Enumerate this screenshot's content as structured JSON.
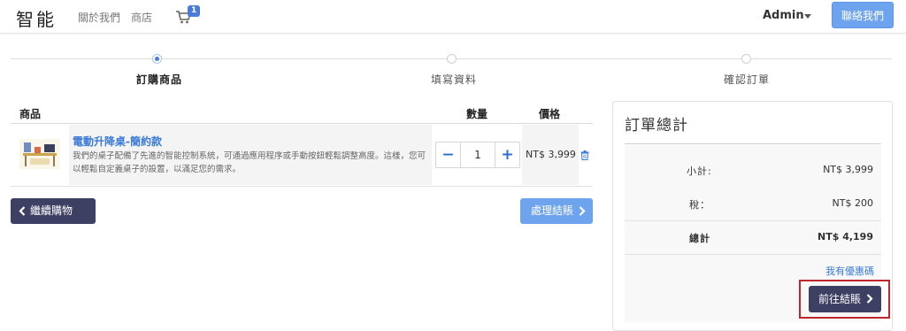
{
  "navbar": {
    "brand": "智能",
    "links": [
      "關於我們",
      "商店"
    ],
    "cart_count": "1",
    "user": "Admin",
    "contact_label": "聯絡我們"
  },
  "steps": [
    {
      "label": "訂購商品",
      "active": true
    },
    {
      "label": "填寫資料",
      "active": false
    },
    {
      "label": "確認訂單",
      "active": false
    }
  ],
  "cart_table": {
    "headers": {
      "product": "商品",
      "quantity": "數量",
      "price": "價格"
    },
    "items": [
      {
        "name": "電動升降桌-簡約款",
        "description": "我們的桌子配備了先進的智能控制系統，可通過應用程序或手動按鈕輕鬆調整高度。這樣，您可以輕鬆自定義桌子的設置，以滿足您的需求。",
        "quantity": "1",
        "price": "NT$ 3,999"
      }
    ],
    "continue_label": "繼續購物",
    "process_label": "處理結賬"
  },
  "summary": {
    "title": "訂單總計",
    "subtotal_label": "小計:",
    "subtotal": "NT$ 3,999",
    "tax_label": "稅：",
    "tax": "NT$ 200",
    "total_label": "總計",
    "total": "NT$ 4,199",
    "coupon_label": "我有優惠碼",
    "checkout_label": "前往結賬"
  },
  "colors": {
    "primary_blue": "#6ea3ee",
    "dark_button": "#3d3f63",
    "link_blue": "#3a7ad8",
    "highlight_red": "#c0272d"
  }
}
